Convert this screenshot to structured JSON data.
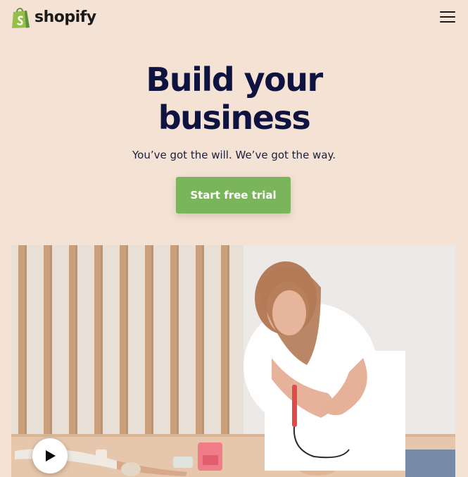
{
  "brand": {
    "name": "shopify",
    "logo_icon": "shopify-bag-icon",
    "accent_color": "#7ab55c"
  },
  "header": {
    "menu_icon": "hamburger-menu-icon"
  },
  "hero": {
    "title_line1": "Build your",
    "title_line2": "business",
    "subtitle": "You’ve got the will. We’ve got the way.",
    "cta_label": "Start free trial",
    "background_color": "#f4e2d4",
    "title_color": "#0f1340"
  },
  "media": {
    "play_icon": "play-icon"
  }
}
